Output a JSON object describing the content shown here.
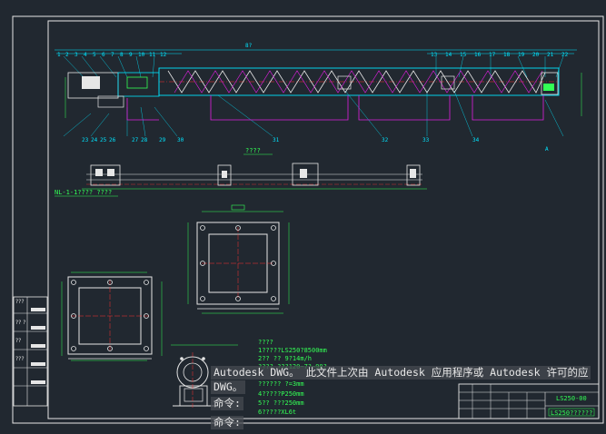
{
  "command_line": {
    "message": "Autodesk DWG。  此文件上次由 Autodesk 应用程序或 Autodesk 许可的应",
    "message_cont": "DWG。",
    "prompt_1": "命令:",
    "prompt_2": "命令:"
  },
  "drawing": {
    "title_block_code": "LS250-00",
    "tech_notes": [
      "????",
      "1?????LS250?8500mm",
      "2?? ?? 9?14m/h",
      "???? ???120~7?~90?",
      "?????? ?=3mm",
      "4?????P250mm",
      "5?? ???250mm",
      "6?????XL6t"
    ],
    "side_labels": [
      "???",
      "?? ?",
      "??",
      "???"
    ]
  },
  "colors": {
    "background": "#212830",
    "cyan": "#00e5ff",
    "green": "#33ff55",
    "magenta": "#e020e0",
    "white": "#e6e6e6",
    "red": "#ff3030",
    "yellow": "#ffff40"
  }
}
